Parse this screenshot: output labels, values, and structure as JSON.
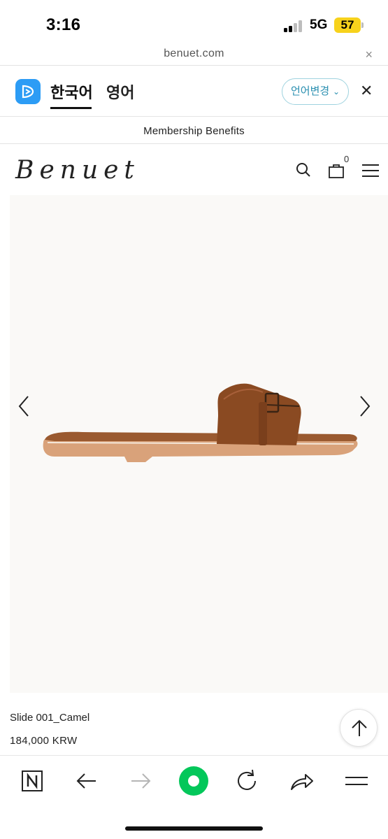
{
  "status_bar": {
    "time": "3:16",
    "network": "5G",
    "battery": "57"
  },
  "url_bar": {
    "domain": "benuet.com",
    "close_icon": "×"
  },
  "translate_bar": {
    "icon": "papago-icon",
    "lang_source": "한국어",
    "lang_target": "영어",
    "change_label": "언어변경",
    "close_icon": "✕"
  },
  "banner": {
    "text": "Membership Benefits"
  },
  "header": {
    "logo": "Benuet",
    "cart_count": "0",
    "icons": [
      "search-icon",
      "shopping-bag-icon",
      "menu-icon"
    ]
  },
  "product": {
    "name": "Slide 001_Camel",
    "price": "184,000 KRW",
    "image": "camel-leather-slide-sandal",
    "colors": {
      "leather": "#8a4a22",
      "sole": "#d9a27a",
      "background": "#faf9f7"
    }
  },
  "toolbar": {
    "items": [
      "naver-home-icon",
      "back-icon",
      "forward-icon",
      "naver-green-dot-icon",
      "reload-icon",
      "share-icon",
      "menu-icon"
    ],
    "accent": "#03c75a"
  }
}
